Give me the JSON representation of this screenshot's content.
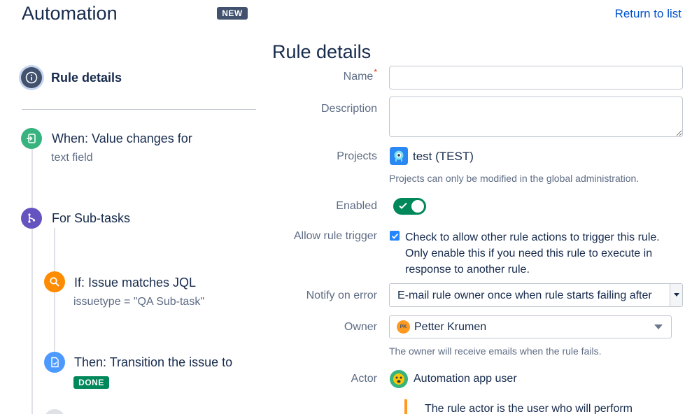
{
  "header": {
    "title": "Automation",
    "badge": "NEW",
    "return_link": "Return to list"
  },
  "flow": {
    "rule_details": "Rule details",
    "trigger": {
      "title": "When: Value changes for",
      "subtitle": "text field"
    },
    "branch": {
      "title": "For Sub-tasks"
    },
    "condition": {
      "title": "If: Issue matches JQL",
      "subtitle": "issuetype = \"QA Sub-task\""
    },
    "action": {
      "title": "Then: Transition the issue to",
      "lozenge": "DONE"
    }
  },
  "form": {
    "title": "Rule details",
    "name": {
      "label": "Name",
      "required_mark": "*",
      "value": ""
    },
    "description": {
      "label": "Description",
      "value": ""
    },
    "projects": {
      "label": "Projects",
      "value": "test (TEST)",
      "help": "Projects can only be modified in the global administration."
    },
    "enabled": {
      "label": "Enabled",
      "on": true
    },
    "allow_trigger": {
      "label": "Allow rule trigger",
      "checked": true,
      "text": "Check to allow other rule actions to trigger this rule. Only enable this if you need this rule to execute in response to another rule."
    },
    "notify": {
      "label": "Notify on error",
      "value": "E-mail rule owner once when rule starts failing after"
    },
    "owner": {
      "label": "Owner",
      "initials": "PK",
      "value": "Petter Krumen",
      "help": "The owner will receive emails when the rule fails."
    },
    "actor": {
      "label": "Actor",
      "value": "Automation app user",
      "note": "The rule actor is the user who will perform"
    }
  },
  "colors": {
    "primary_text": "#172b4d",
    "secondary_text": "#5e6c84",
    "link": "#0052cc",
    "trigger_icon": "#36b37e",
    "branch_icon": "#6554c0",
    "condition_icon": "#ff8b00",
    "action_icon": "#4c9aff",
    "enabled_toggle": "#00875a",
    "warning_bar": "#ff991f"
  },
  "icons": {
    "rule_details": "info-icon",
    "trigger": "trigger-icon",
    "branch": "branch-icon",
    "condition": "search-icon",
    "action": "document-icon"
  }
}
